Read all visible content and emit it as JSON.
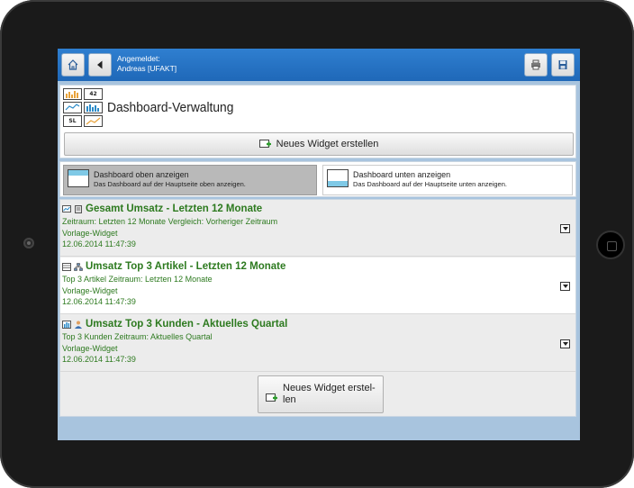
{
  "header": {
    "login_label": "Angemeldet:",
    "login_user": "Andreas [UFAKT]"
  },
  "logo_tiles": [
    "42",
    "SL"
  ],
  "page": {
    "title": "Dashboard-Verwaltung"
  },
  "actions": {
    "new_widget_top": "Neues Widget erstellen",
    "new_widget_bottom": "Neues Widget erstel-len"
  },
  "dashboard_options": [
    {
      "title": "Dashboard oben anzeigen",
      "desc": "Das Dashboard auf der Hauptseite oben anzeigen."
    },
    {
      "title": "Dashboard unten anzeigen",
      "desc": "Das Dashboard auf der Hauptseite unten anzeigen."
    }
  ],
  "widgets": [
    {
      "title": "Gesamt Umsatz - Letzten 12 Monate",
      "line1": "Zeitraum: Letzten 12 Monate Vergleich: Vorheriger Zeitraum",
      "line2": "Vorlage-Widget",
      "line3": "12.06.2014 11:47:39"
    },
    {
      "title": "Umsatz Top 3 Artikel - Letzten 12 Monate",
      "line1": "Top 3 Artikel Zeitraum: Letzten 12 Monate",
      "line2": "Vorlage-Widget",
      "line3": "12.06.2014 11:47:39"
    },
    {
      "title": "Umsatz Top 3 Kunden - Aktuelles Quartal",
      "line1": "Top 3 Kunden Zeitraum: Aktuelles Quartal",
      "line2": "Vorlage-Widget",
      "line3": "12.06.2014 11:47:39"
    }
  ],
  "colors": {
    "header_blue": "#1f68b8",
    "widget_text_green": "#2d7a1f",
    "selected_option": "#b9b9b9"
  }
}
